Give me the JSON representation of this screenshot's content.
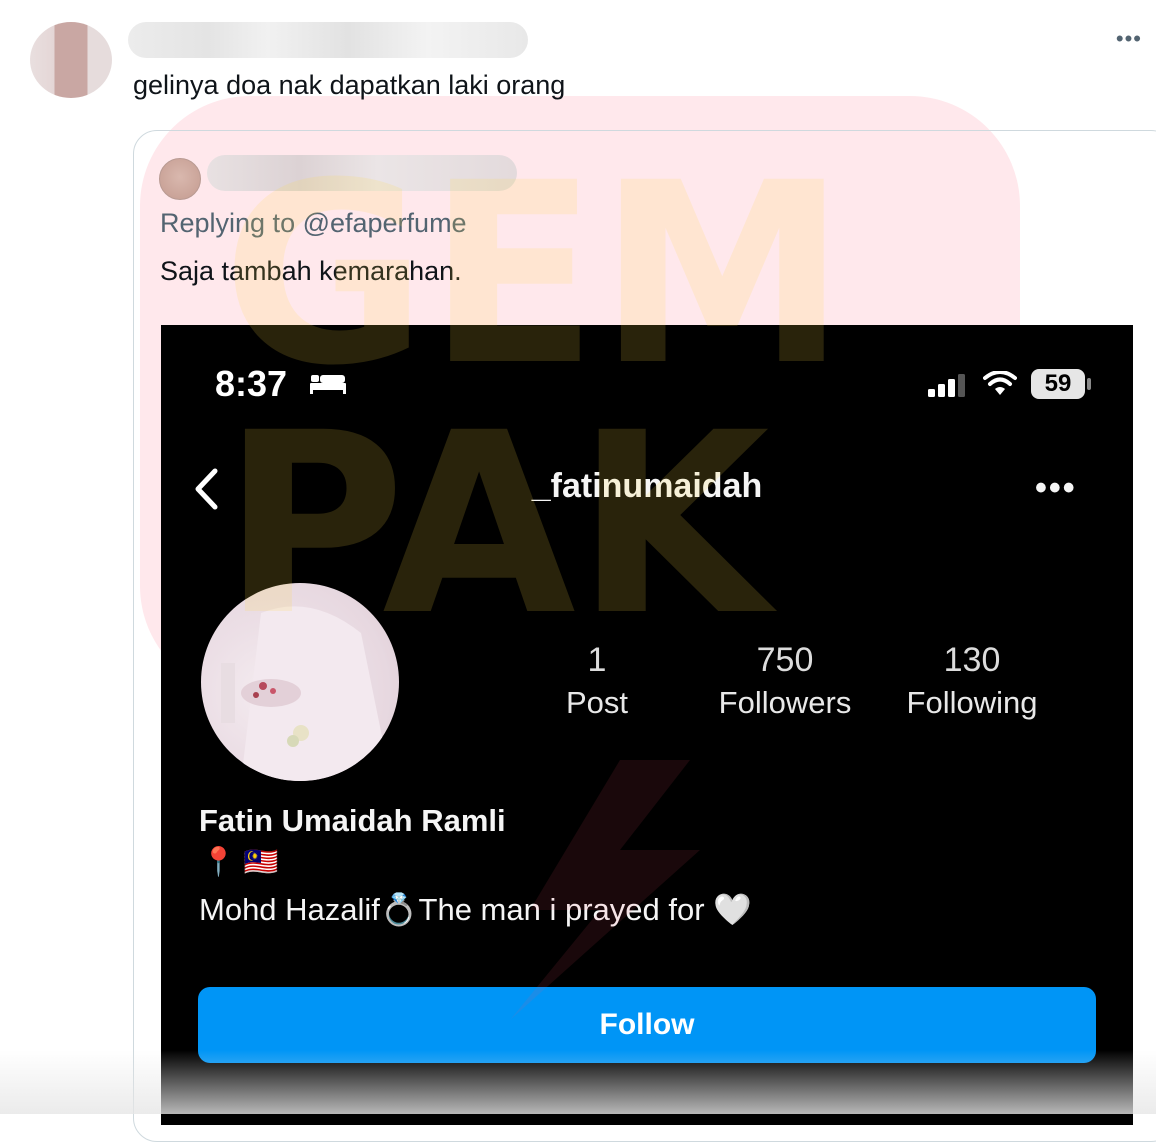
{
  "tweet": {
    "text": "gelinya doa nak dapatkan laki orang",
    "more_icon": "more-horizontal-icon"
  },
  "quoted_tweet": {
    "replying_to": "Replying to @efaperfume",
    "text": "Saja tambah kemarahan."
  },
  "screenshot": {
    "status_bar": {
      "time": "8:37",
      "battery": "59"
    },
    "nav": {
      "username": "_fatinumaidah",
      "more": "•••"
    },
    "stats": [
      {
        "value": "1",
        "label": "Post"
      },
      {
        "value": "750",
        "label": "Followers"
      },
      {
        "value": "130",
        "label": "Following"
      }
    ],
    "full_name": "Fatin Umaidah Ramli",
    "location_line": "📍 🇲🇾",
    "bio": "Mohd Hazalif💍The man i prayed for 🤍",
    "follow_label": "Follow"
  },
  "watermark": {
    "line1": "GEM",
    "line2": "PAK"
  },
  "colors": {
    "follow_blue": "#0095f6",
    "twitter_gray": "#536471",
    "card_border": "#cfd9de"
  }
}
